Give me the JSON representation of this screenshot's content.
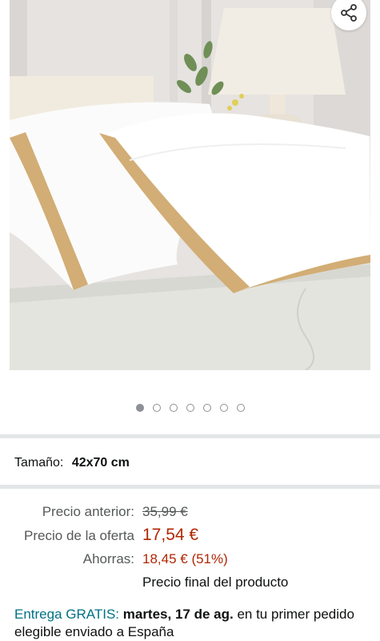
{
  "product_image": {
    "alt": "",
    "share_icon": "share-icon"
  },
  "carousel": {
    "count": 7,
    "active_index": 0
  },
  "size": {
    "label": "Tamaño:",
    "value": "42x70 cm"
  },
  "pricing": {
    "previous_label": "Precio anterior:",
    "previous_value": "35,99 €",
    "offer_label": "Precio de la oferta",
    "offer_value": "17,54 €",
    "savings_label": "Ahorras:",
    "savings_value": "18,45 € (51%)",
    "final_note": "Precio final del producto"
  },
  "delivery": {
    "prefix": "Entrega GRATIS:",
    "date": "martes, 17 de ag.",
    "suffix": "en tu primer pedido elegible enviado a España"
  },
  "colors": {
    "price_red": "#b12704",
    "link_teal": "#007185",
    "muted": "#565959",
    "divider": "#e3e6e6",
    "gold_trim": "#c9a46b"
  }
}
